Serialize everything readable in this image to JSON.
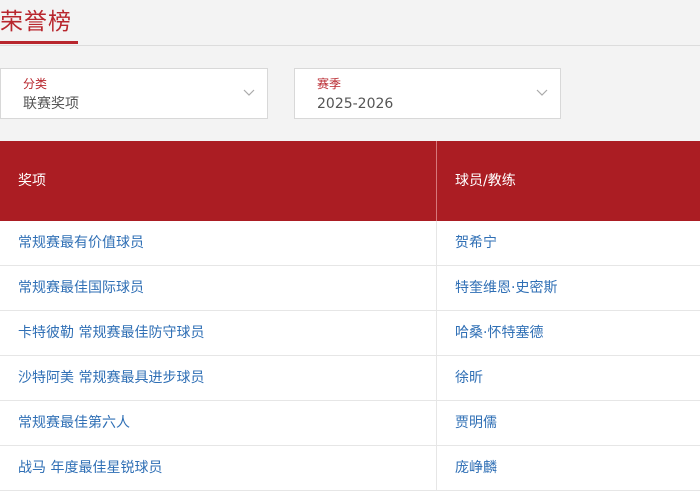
{
  "header": {
    "title": "荣誉榜"
  },
  "filters": {
    "category": {
      "label": "分类",
      "value": "联赛奖项"
    },
    "season": {
      "label": "赛季",
      "value": "2025-2026"
    }
  },
  "table": {
    "columns": [
      "奖项",
      "球员/教练"
    ],
    "rows": [
      {
        "award": "常规赛最有价值球员",
        "winner": "贺希宁"
      },
      {
        "award": "常规赛最佳国际球员",
        "winner": "特奎维恩·史密斯"
      },
      {
        "award": "卡特彼勒 常规赛最佳防守球员",
        "winner": "哈桑·怀特塞德"
      },
      {
        "award": "沙特阿美 常规赛最具进步球员",
        "winner": "徐昕"
      },
      {
        "award": "常规赛最佳第六人",
        "winner": "贾明儒"
      },
      {
        "award": "战马 年度最佳星锐球员",
        "winner": "庞峥麟"
      }
    ]
  },
  "colors": {
    "accent": "#b8262d",
    "header_bg": "#ab1d23",
    "link": "#2f6fb5"
  },
  "icons": {
    "dropdown": "chevron-down-icon"
  }
}
